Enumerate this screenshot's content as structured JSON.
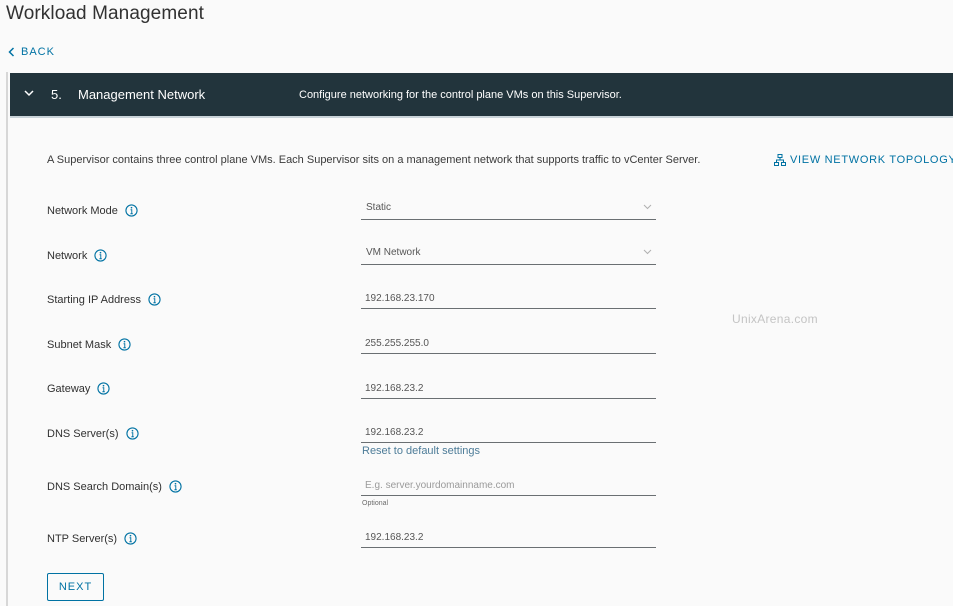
{
  "page": {
    "title": "Workload Management",
    "back_label": "BACK"
  },
  "step": {
    "number": "5.",
    "name": "Management Network",
    "description": "Configure networking for the control plane VMs on this Supervisor."
  },
  "intro": {
    "text": "A Supervisor contains three control plane VMs. Each Supervisor sits on a management network that supports traffic to vCenter Server.",
    "topology_link": "VIEW NETWORK TOPOLOGY"
  },
  "fields": [
    {
      "label": "Network Mode",
      "type": "select",
      "value": "Static"
    },
    {
      "label": "Network",
      "type": "select",
      "value": "VM Network"
    },
    {
      "label": "Starting IP Address",
      "type": "text",
      "value": "192.168.23.170"
    },
    {
      "label": "Subnet Mask",
      "type": "text",
      "value": "255.255.255.0"
    },
    {
      "label": "Gateway",
      "type": "text",
      "value": "192.168.23.2"
    },
    {
      "label": "DNS Server(s)",
      "type": "text",
      "value": "192.168.23.2"
    },
    {
      "label": "DNS Search Domain(s)",
      "type": "text",
      "value": "",
      "placeholder": "E.g. server.yourdomainname.com",
      "helper": "Optional"
    },
    {
      "label": "NTP Server(s)",
      "type": "text",
      "value": "192.168.23.2"
    }
  ],
  "reset_label": "Reset to default settings",
  "next_label": "NEXT",
  "watermark": "UnixArena.com",
  "colors": {
    "header_bg": "#22343c",
    "link": "#0072a3",
    "page_bg": "#fafafa"
  }
}
